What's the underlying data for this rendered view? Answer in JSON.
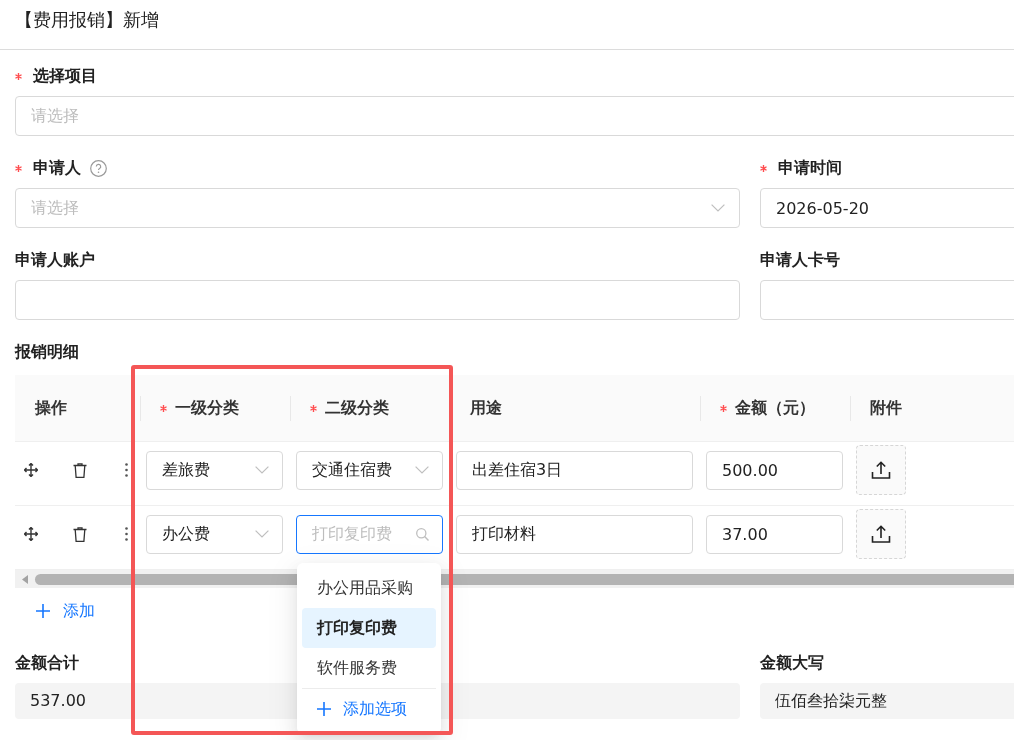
{
  "page": {
    "title": "【费用报销】新增"
  },
  "form": {
    "rows": [
      [
        {
          "kind": "select",
          "label": "选择项目",
          "required": true,
          "help": false,
          "placeholder": "请选择"
        }
      ],
      [
        {
          "kind": "select",
          "label": "申请人",
          "required": true,
          "help": true,
          "placeholder": "请选择"
        },
        {
          "kind": "date",
          "label": "申请时间",
          "required": true,
          "help": false,
          "value": "2026-05-20"
        }
      ],
      [
        {
          "kind": "text",
          "label": "申请人账户",
          "required": false,
          "help": false
        },
        {
          "kind": "text",
          "label": "申请人卡号",
          "required": false,
          "help": false
        }
      ]
    ]
  },
  "details": {
    "label": "报销明细",
    "columns": [
      {
        "label": "操作",
        "required": false
      },
      {
        "label": "一级分类",
        "required": true
      },
      {
        "label": "二级分类",
        "required": true
      },
      {
        "label": "用途",
        "required": false
      },
      {
        "label": "金额（元）",
        "required": true
      },
      {
        "label": "附件",
        "required": false
      }
    ],
    "rows": [
      {
        "category": "差旅费",
        "subcategory": {
          "value": "交通住宿费",
          "focused": false
        },
        "purpose": "出差住宿3日",
        "amount": "500.00"
      },
      {
        "category": "办公费",
        "subcategory": {
          "placeholder": "打印复印费",
          "focused": true,
          "options": [
            {
              "label": "办公用品采购",
              "selected": false
            },
            {
              "label": "打印复印费",
              "selected": true
            },
            {
              "label": "软件服务费",
              "selected": false
            }
          ],
          "add_option": "添加选项"
        },
        "purpose": "打印材料",
        "amount": "37.00"
      }
    ],
    "add_label": "添加"
  },
  "summary": {
    "rows": [
      [
        {
          "kind": "readonly",
          "label": "金额合计",
          "required": false,
          "help": false,
          "value": "537.00"
        },
        {
          "kind": "readonly",
          "label": "金额大写",
          "required": false,
          "help": false,
          "value": "伍佰叁拾柒元整"
        }
      ]
    ]
  }
}
